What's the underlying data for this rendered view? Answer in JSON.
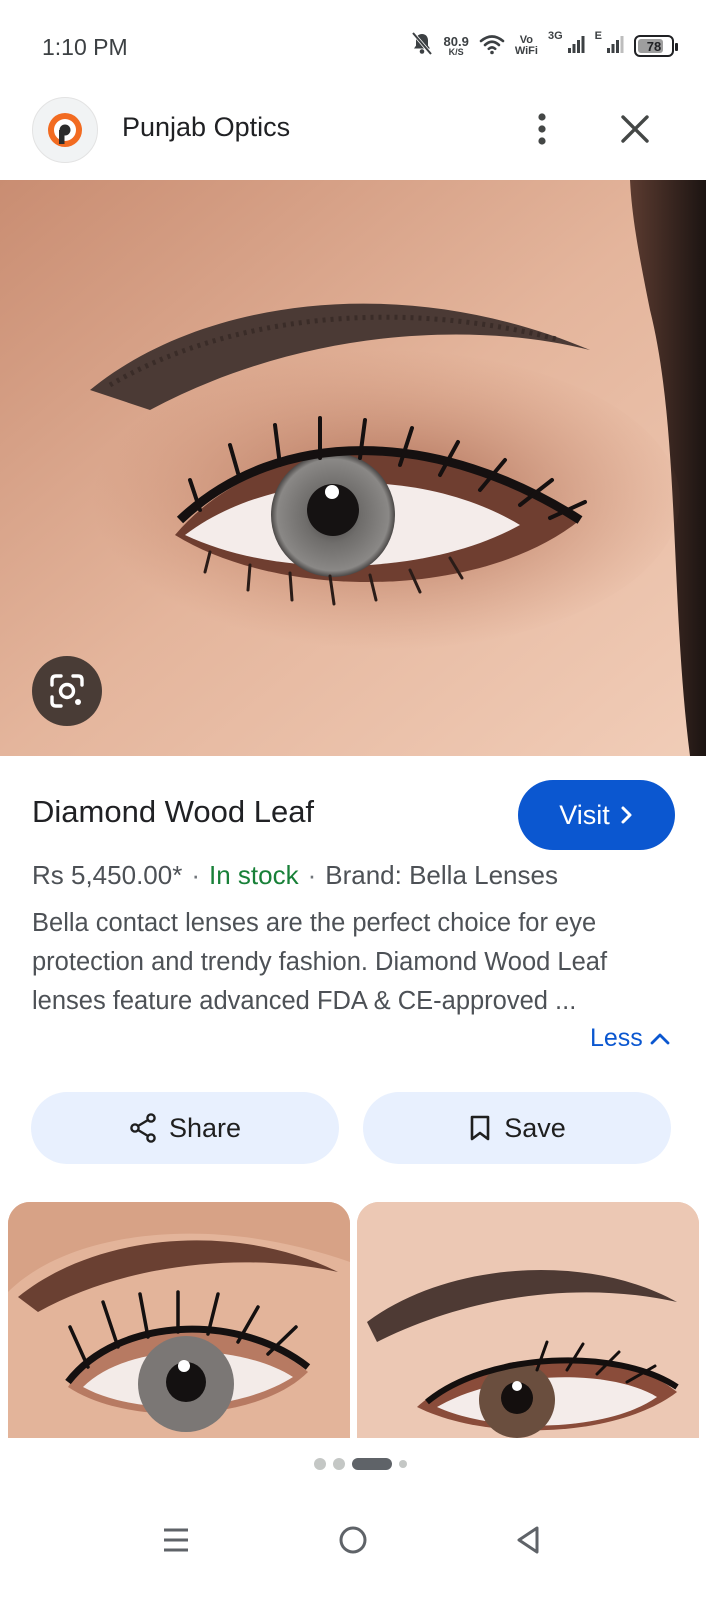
{
  "status_bar": {
    "time": "1:10 PM",
    "net_speed_value": "80.9",
    "net_speed_unit": "K/S",
    "vowifi_top": "Vo",
    "vowifi_bottom": "WiFi",
    "sim1_label": "3G",
    "sim2_label": "E",
    "battery_level": "78",
    "battery_fraction": 0.78,
    "icons": [
      "bell-off-icon",
      "wifi-icon",
      "signal-icon",
      "signal-icon",
      "battery-icon"
    ]
  },
  "header": {
    "site_name": "Punjab Optics",
    "logo_icon": "punjab-optics-logo",
    "more_icon": "more-vert-icon",
    "close_icon": "close-icon"
  },
  "hero": {
    "image_subject": "eye-closeup-photo",
    "lens_icon": "google-lens-icon"
  },
  "product": {
    "title": "Diamond Wood Leaf",
    "visit_label": "Visit",
    "price": "Rs 5,450.00*",
    "separator": "·",
    "stock": "In stock",
    "brand": "Brand: Bella Lenses",
    "description": "Bella contact lenses are the perfect choice for eye protection and trendy fashion. Diamond Wood Leaf lenses feature advanced FDA & CE-approved ...",
    "less_label": "Less"
  },
  "actions": {
    "share_label": "Share",
    "save_label": "Save"
  },
  "pager": {
    "count": 4,
    "active_index": 2
  },
  "colors": {
    "accent": "#0b57d0",
    "stock_green": "#188038",
    "pill_bg": "#e8f0fe",
    "text_secondary": "#4d5156"
  }
}
